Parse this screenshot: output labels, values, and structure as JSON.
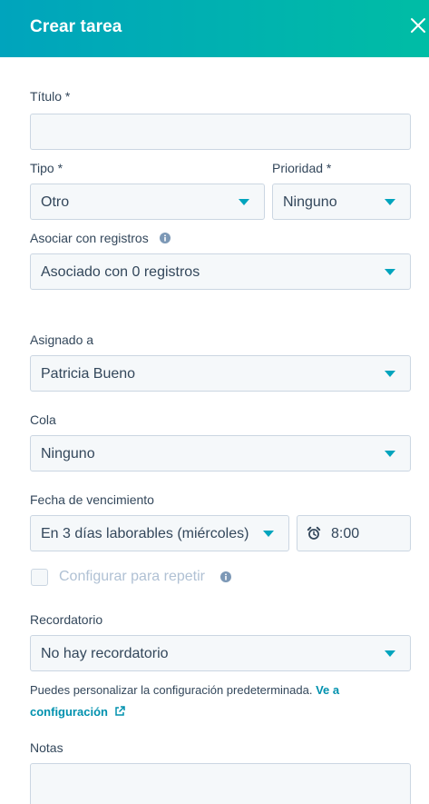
{
  "header": {
    "title": "Crear tarea"
  },
  "title_field": {
    "label": "Título *",
    "value": ""
  },
  "type_field": {
    "label": "Tipo *",
    "value": "Otro"
  },
  "priority_field": {
    "label": "Prioridad *",
    "value": "Ninguno"
  },
  "associate_field": {
    "label": "Asociar con registros",
    "value": "Asociado con 0 registros"
  },
  "assigned_field": {
    "label": "Asignado a",
    "value": "Patricia Bueno"
  },
  "queue_field": {
    "label": "Cola",
    "value": "Ninguno"
  },
  "due_date_field": {
    "label": "Fecha de vencimiento",
    "date_value": "En 3 días laborables (miércoles)",
    "time_value": "8:00"
  },
  "repeat": {
    "label": "Configurar para repetir",
    "checked": false
  },
  "reminder_field": {
    "label": "Recordatorio",
    "value": "No hay recordatorio"
  },
  "help": {
    "text": "Puedes personalizar la configuración predeterminada.",
    "link_text": "Ve a configuración"
  },
  "notes_field": {
    "label": "Notas",
    "value": ""
  },
  "colors": {
    "header_start": "#00a4bd",
    "header_end": "#00bda5",
    "accent": "#00a4bd",
    "link": "#0091ae",
    "text": "#33475b"
  },
  "icons": {
    "close": "close-icon",
    "info": "info-icon",
    "alarm": "alarm-clock-icon",
    "external": "external-link-icon",
    "dropdown": "caret-down-icon"
  }
}
